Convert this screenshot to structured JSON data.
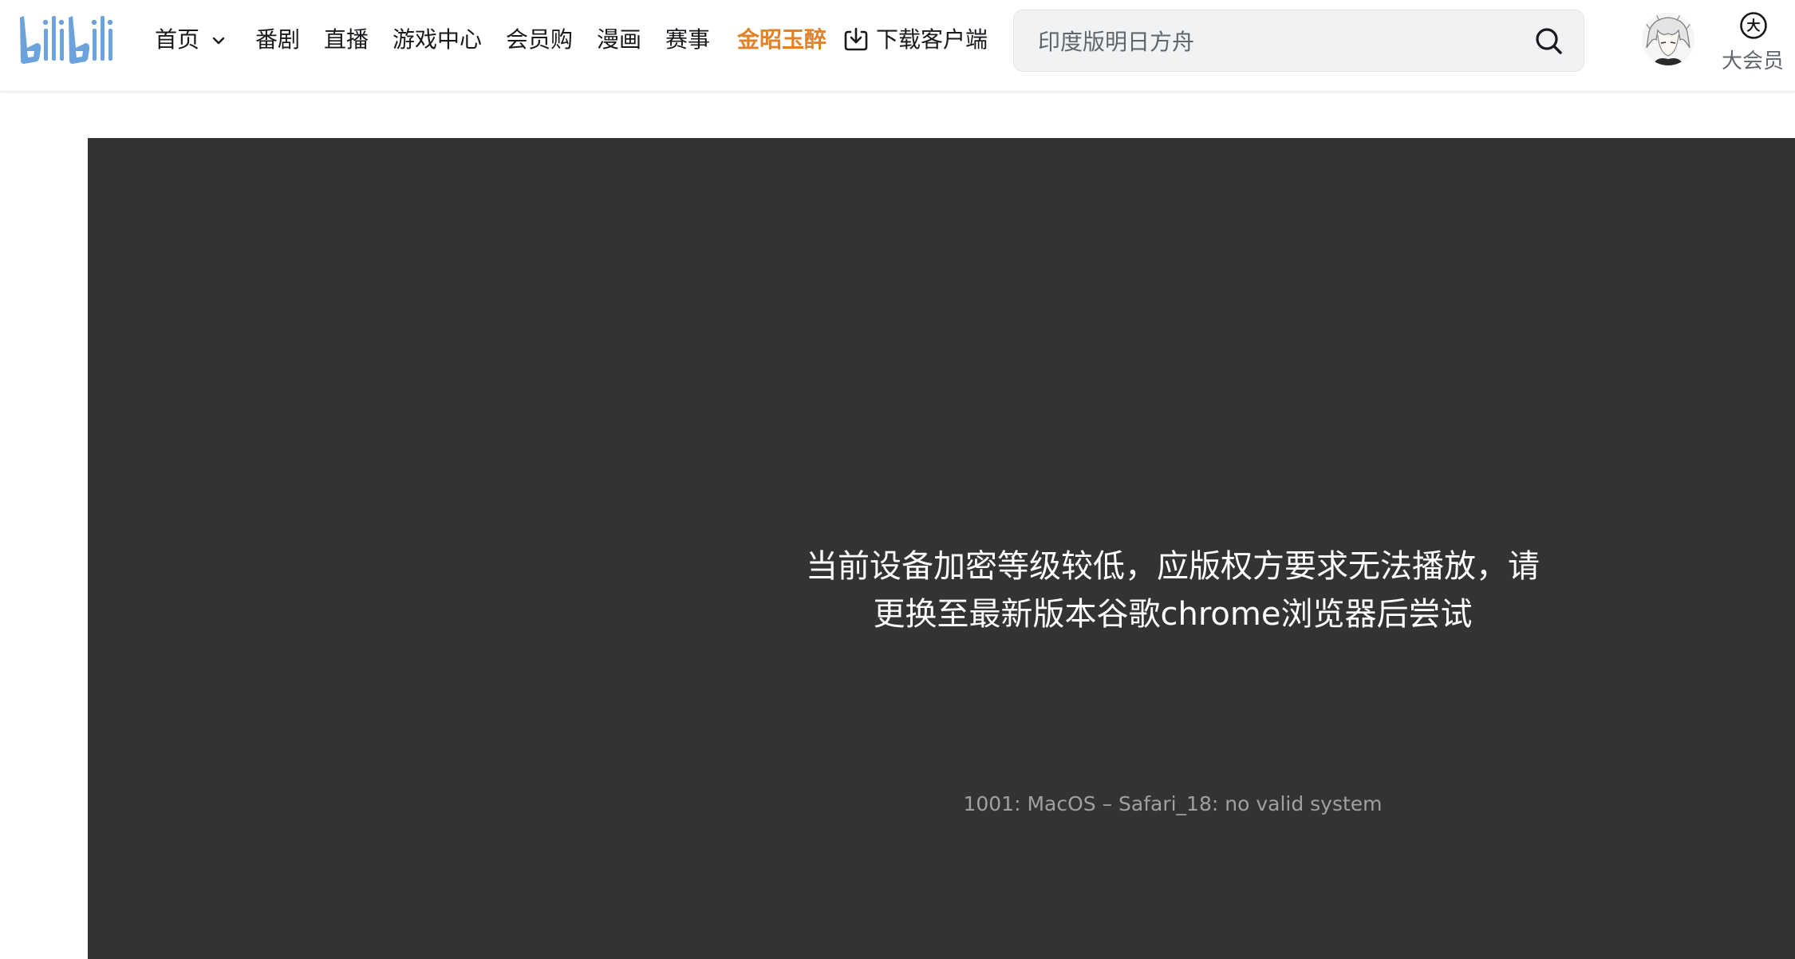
{
  "header": {
    "logo_text": "bilibili",
    "nav": [
      {
        "label": "首页"
      },
      {
        "label": "番剧"
      },
      {
        "label": "直播"
      },
      {
        "label": "游戏中心"
      },
      {
        "label": "会员购"
      },
      {
        "label": "漫画"
      },
      {
        "label": "赛事"
      },
      {
        "label": "金昭玉醉"
      },
      {
        "label": "下载客户端"
      }
    ],
    "search": {
      "placeholder": "印度版明日方舟"
    },
    "vip_label": "大会员",
    "vip_icon_char": "大"
  },
  "player": {
    "error_line1": "当前设备加密等级较低，应版权方要求无法播放，请",
    "error_line2": "更换至最新版本谷歌chrome浏览器后尝试",
    "error_code": "1001: MacOS – Safari_18: no valid system"
  },
  "colors": {
    "brand": "#00a1d6",
    "logo": "#6ca3dd",
    "highlight": "#e0822a",
    "player_bg": "#333333"
  }
}
